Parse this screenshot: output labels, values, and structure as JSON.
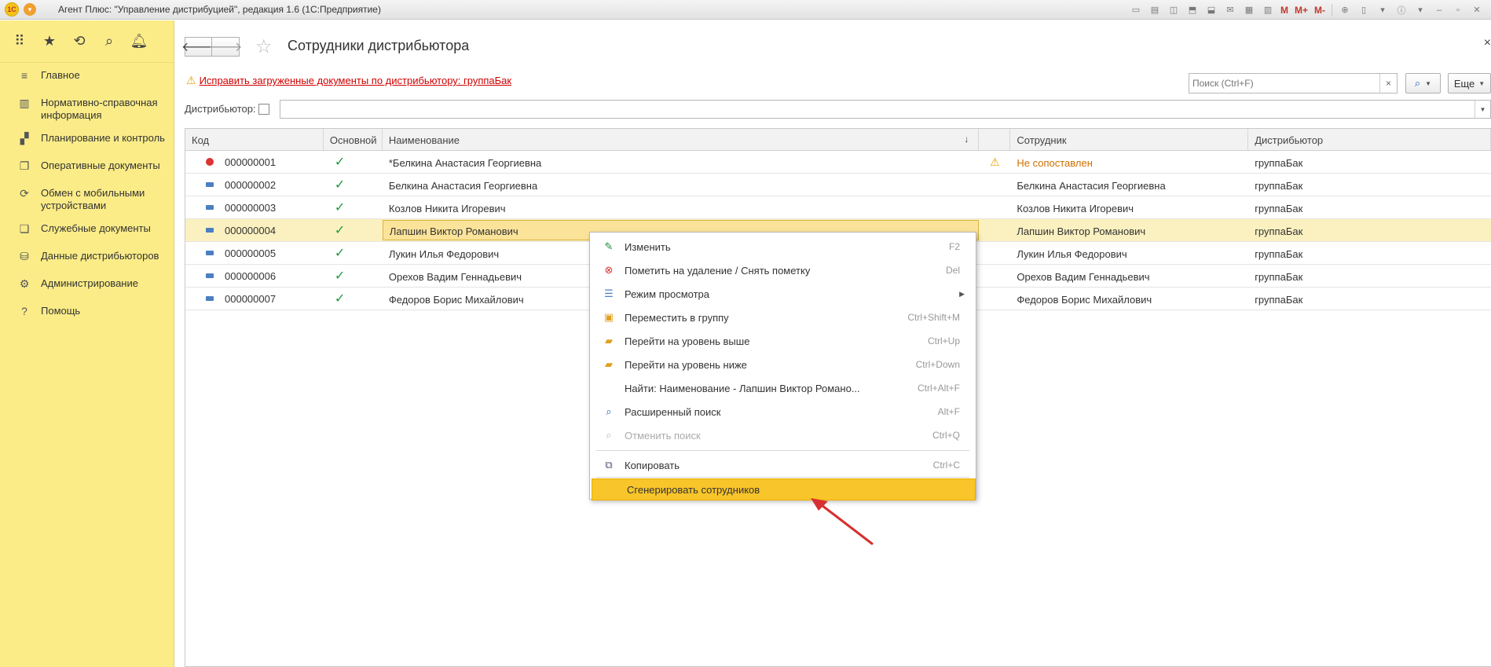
{
  "window": {
    "logo": "1С",
    "title": "Агент Плюс: \"Управление дистрибуцией\", редакция 1.6  (1С:Предприятие)",
    "tools": [
      "M",
      "M+",
      "M-"
    ]
  },
  "sidebar": {
    "items": [
      {
        "label": "Главное",
        "icon": "list-icon"
      },
      {
        "label": "Нормативно-справочная информация",
        "icon": "grid-icon"
      },
      {
        "label": "Планирование и контроль",
        "icon": "chart-icon"
      },
      {
        "label": "Оперативные документы",
        "icon": "docs-icon"
      },
      {
        "label": "Обмен с мобильными устройствами",
        "icon": "sync-icon"
      },
      {
        "label": "Служебные документы",
        "icon": "service-docs-icon"
      },
      {
        "label": "Данные дистрибьюторов",
        "icon": "distributor-icon"
      },
      {
        "label": "Администрирование",
        "icon": "gear-icon"
      },
      {
        "label": "Помощь",
        "icon": "help-icon"
      }
    ]
  },
  "page": {
    "title": "Сотрудники дистрибьютора",
    "warning_link": "Исправить загруженные документы по дистрибьютору: группаБак",
    "search_placeholder": "Поиск (Ctrl+F)",
    "more_label": "Еще",
    "distributor_label": "Дистрибьютор:"
  },
  "table": {
    "columns": {
      "code": "Код",
      "main": "Основной",
      "name": "Наименование",
      "warn": "",
      "employee": "Сотрудник",
      "distributor": "Дистрибьютор"
    },
    "rows": [
      {
        "code": "000000001",
        "main": "✓",
        "name": "*Белкина Анастасия Георгиевна",
        "warn": "⚠",
        "employee": "Не сопоставлен",
        "distributor": "группаБак"
      },
      {
        "code": "000000002",
        "main": "✓",
        "name": "Белкина Анастасия Георгиевна",
        "warn": "",
        "employee": "Белкина Анастасия Георгиевна",
        "distributor": "группаБак"
      },
      {
        "code": "000000003",
        "main": "✓",
        "name": "Козлов Никита Игоревич",
        "warn": "",
        "employee": "Козлов Никита Игоревич",
        "distributor": "группаБак"
      },
      {
        "code": "000000004",
        "main": "✓",
        "name": "Лапшин Виктор Романович",
        "warn": "",
        "employee": "Лапшин Виктор Романович",
        "distributor": "группаБак"
      },
      {
        "code": "000000005",
        "main": "✓",
        "name": "Лукин Илья Федорович",
        "warn": "",
        "employee": "Лукин Илья Федорович",
        "distributor": "группаБак"
      },
      {
        "code": "000000006",
        "main": "✓",
        "name": "Орехов Вадим Геннадьевич",
        "warn": "",
        "employee": "Орехов Вадим Геннадьевич",
        "distributor": "группаБак"
      },
      {
        "code": "000000007",
        "main": "✓",
        "name": "Федоров Борис Михайлович",
        "warn": "",
        "employee": "Федоров Борис Михайлович",
        "distributor": "группаБак"
      }
    ]
  },
  "context_menu": {
    "items": [
      {
        "label": "Изменить",
        "key": "F2"
      },
      {
        "label": "Пометить на удаление / Снять пометку",
        "key": "Del"
      },
      {
        "label": "Режим просмотра",
        "key": ""
      },
      {
        "label": "Переместить в группу",
        "key": "Ctrl+Shift+M"
      },
      {
        "label": "Перейти на уровень выше",
        "key": "Ctrl+Up"
      },
      {
        "label": "Перейти на уровень ниже",
        "key": "Ctrl+Down"
      },
      {
        "label": "Найти: Наименование - Лапшин Виктор Романо...",
        "key": "Ctrl+Alt+F"
      },
      {
        "label": "Расширенный поиск",
        "key": "Alt+F"
      },
      {
        "label": "Отменить поиск",
        "key": "Ctrl+Q"
      },
      {
        "label": "Копировать",
        "key": "Ctrl+C"
      },
      {
        "label": "Сгенерировать сотрудников",
        "key": ""
      }
    ]
  },
  "colors": {
    "sidebar_bg": "#fbec88",
    "highlight": "#f8c52a",
    "link_red": "#d00000",
    "check_green": "#1e9a3c",
    "arrow_red": "#d83030"
  }
}
